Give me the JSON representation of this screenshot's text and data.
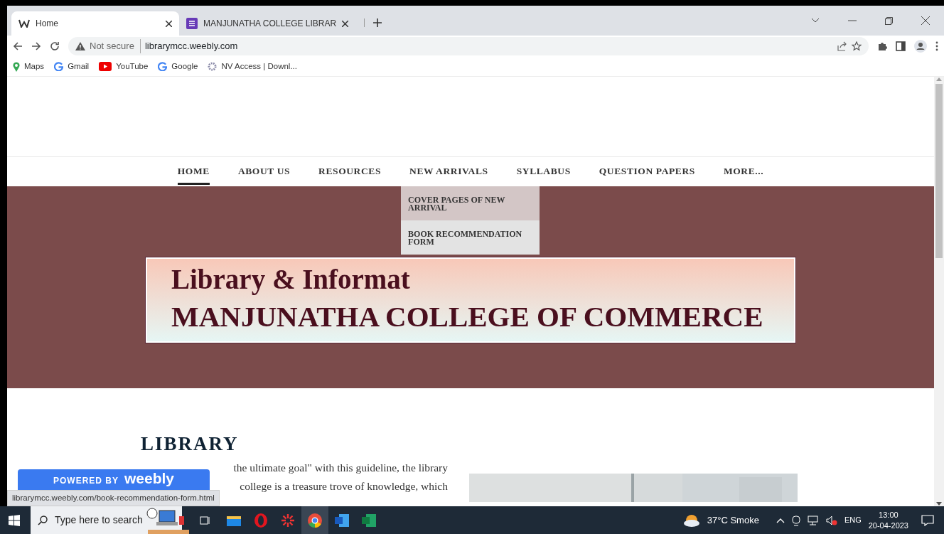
{
  "browser": {
    "tabs": [
      {
        "title": "Home",
        "selected": true
      },
      {
        "title": "MANJUNATHA COLLEGE LIBRAR",
        "selected": false
      }
    ],
    "address": {
      "security": "Not secure",
      "url": "librarymcc.weebly.com"
    },
    "bookmarks": [
      "Maps",
      "Gmail",
      "YouTube",
      "Google",
      "NV Access | Downl..."
    ]
  },
  "site": {
    "nav": [
      {
        "label": "HOME",
        "selected": true
      },
      {
        "label": "ABOUT US",
        "selected": false
      },
      {
        "label": "RESOURCES",
        "selected": false
      },
      {
        "label": "NEW ARRIVALS",
        "selected": false,
        "dropdown": [
          {
            "label": "COVER PAGES OF NEW ARRIVAL",
            "selected": true
          },
          {
            "label": "BOOK RECOMMENDATION FORM",
            "selected": false
          }
        ]
      },
      {
        "label": "SYLLABUS",
        "selected": false
      },
      {
        "label": "QUESTION PAPERS",
        "selected": false
      },
      {
        "label": "MORE...",
        "selected": false
      }
    ],
    "banner": {
      "line_1": "Library & Informat",
      "line_2": "MANJUNATHA COLLEGE OF COMMERCE"
    },
    "section": {
      "heading": "LIBRARY",
      "lines": [
        "the ultimate goal\" with this guideline, the library",
        "college is a treasure trove of knowledge, which"
      ]
    },
    "badge": {
      "prefix": "POWERED BY",
      "brand": "weebly"
    }
  },
  "status_url": "librarymcc.weebly.com/book-recommendation-form.html",
  "taskbar": {
    "search_placeholder": "Type here to search",
    "weather": "37°C  Smoke",
    "language": "ENG",
    "time": "13:00",
    "date": "20-04-2023"
  }
}
